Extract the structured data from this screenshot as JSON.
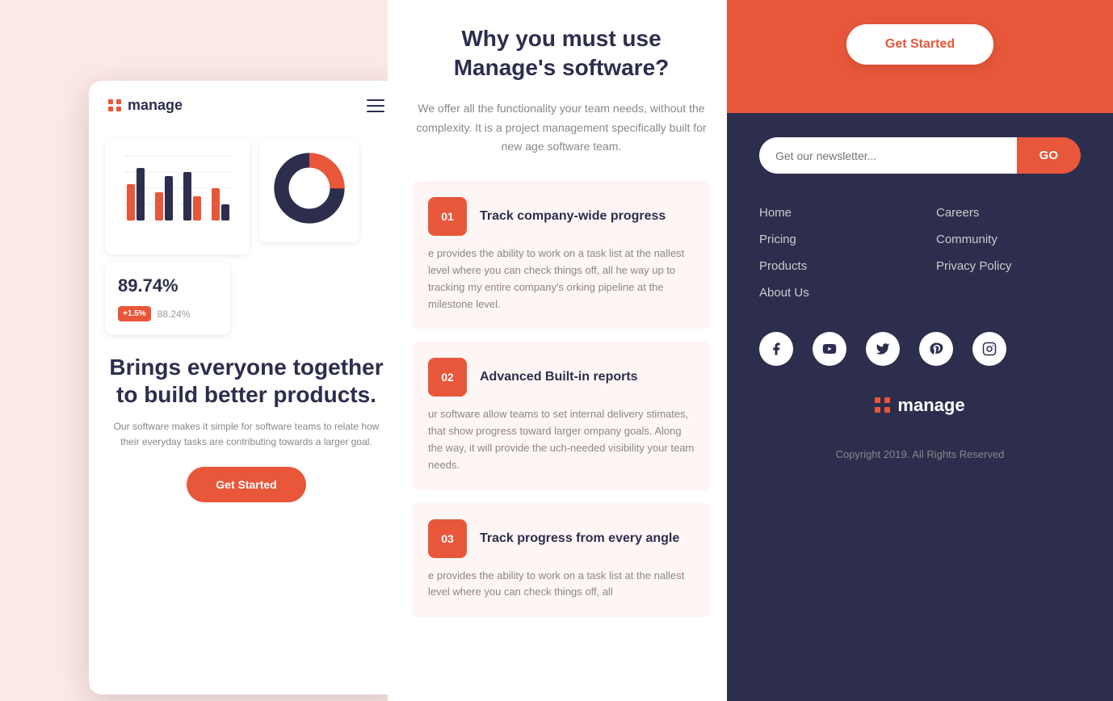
{
  "app": {
    "name": "manage"
  },
  "mobile": {
    "logo": "manage",
    "stat_big": "89.74%",
    "stat_badge": "+1.5%",
    "stat_secondary": "88.24%",
    "hero_title": "Brings everyone together to build better products.",
    "hero_subtitle": "Our software makes it simple for software teams to relate how their everyday tasks are contributing towards a larger goal.",
    "cta_label": "Get Started"
  },
  "middle": {
    "section_title": "Why you must use Manage's software?",
    "section_desc": "We offer all the functionality your team needs, without the complexity. It is a project management specifically built for new age software team.",
    "features": [
      {
        "num": "01",
        "title": "Track company-wide progress",
        "desc": "e provides the ability to work on a task list at the nallest level where you can check things off, all he way up to tracking my entire company's orking pipeline at the milestone level."
      },
      {
        "num": "02",
        "title": "Advanced Built-in reports",
        "desc": "ur software allow teams to set internal delivery stimates, that show progress toward larger ompany goals. Along the way, it will provide the uch-needed visibility your team needs."
      },
      {
        "num": "03",
        "title": "Track progress from every angle",
        "desc": "e provides the ability to work on a task list at the nallest level where you can check things off, all"
      }
    ]
  },
  "footer": {
    "cta_button": "Get Started",
    "newsletter_placeholder": "Get our newsletter...",
    "newsletter_btn": "GO",
    "nav_links": [
      {
        "label": "Home",
        "col": 1
      },
      {
        "label": "Careers",
        "col": 2
      },
      {
        "label": "Pricing",
        "col": 1
      },
      {
        "label": "Community",
        "col": 2
      },
      {
        "label": "Products",
        "col": 1
      },
      {
        "label": "Privacy Policy",
        "col": 2
      },
      {
        "label": "About Us",
        "col": 1
      }
    ],
    "social_icons": [
      "facebook",
      "youtube",
      "twitter",
      "pinterest",
      "instagram"
    ],
    "logo": "manage",
    "copyright": "Copyright 2019. All Rights Reserved"
  },
  "colors": {
    "orange": "#e8573a",
    "dark": "#2d2d4e",
    "light_bg": "#fce8e4"
  }
}
